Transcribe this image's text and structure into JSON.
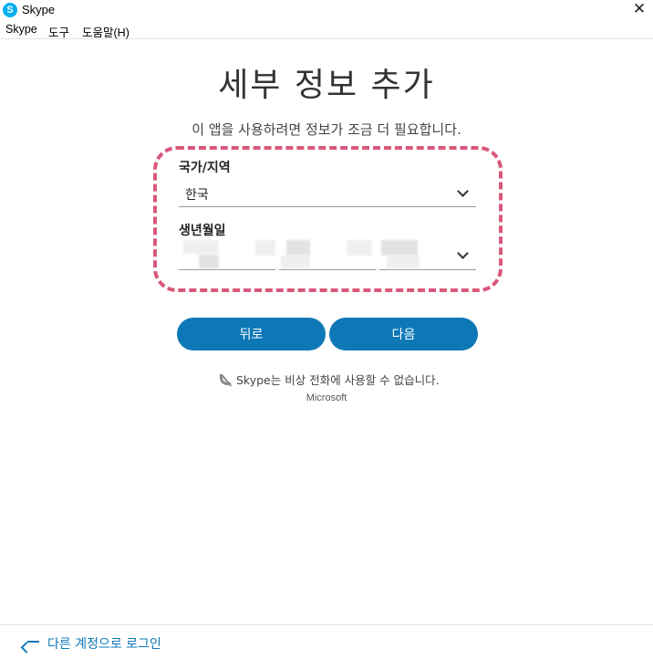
{
  "window": {
    "title": "Skype",
    "app_icon_glyph": "S",
    "close_glyph": "✕"
  },
  "menu": {
    "items": [
      "Skype",
      "도구",
      "도움말(H)"
    ]
  },
  "page": {
    "title": "세부 정보 추가",
    "subtitle": "이 앱을 사용하려면 정보가 조금 더 필요합니다."
  },
  "form": {
    "country": {
      "label": "국가/지역",
      "value": "한국"
    },
    "birthday": {
      "label": "생년월일",
      "note": "values obscured (blurred) in screenshot"
    }
  },
  "buttons": {
    "back": "뒤로",
    "next": "다음"
  },
  "notice": {
    "text": "Skype는 비상 전화에 사용할 수 없습니다.",
    "icon": "no-phone-icon"
  },
  "brand": "Microsoft",
  "footer": {
    "link": "다른 계정으로 로그인",
    "icon": "back-arrow-icon"
  },
  "colors": {
    "accent": "#0e78b6",
    "skype_blue": "#00aff0",
    "highlight_dash": "#d9587a"
  }
}
